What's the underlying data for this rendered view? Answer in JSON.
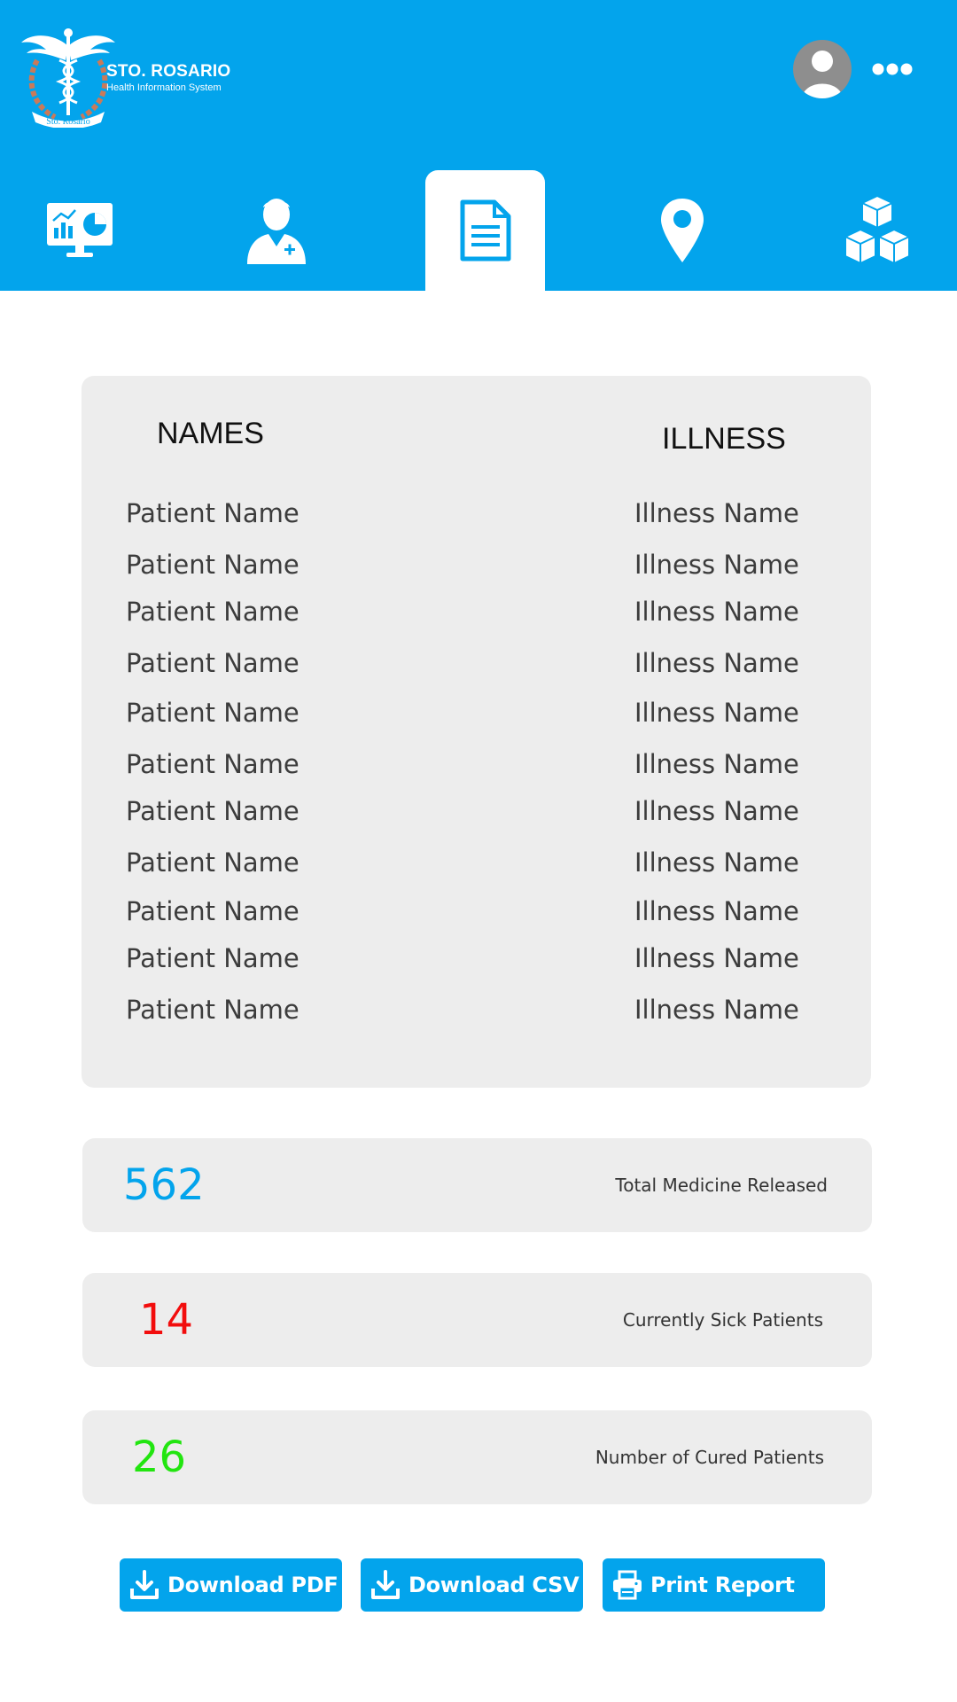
{
  "header": {
    "brand_name": "STO. ROSARIO",
    "brand_subtitle": "Health Information System",
    "logo_text": "Sto. Rosario",
    "bg_color": "#03A4EC"
  },
  "nav": {
    "tabs": [
      {
        "icon": "dashboard-monitor-icon",
        "active": false
      },
      {
        "icon": "doctor-icon",
        "active": false
      },
      {
        "icon": "document-icon",
        "active": true
      },
      {
        "icon": "location-pin-icon",
        "active": false
      },
      {
        "icon": "boxes-icon",
        "active": false
      }
    ]
  },
  "table": {
    "headers": {
      "names": "NAMES",
      "illness": "ILLNESS"
    },
    "rows": [
      {
        "name": "Patient Name",
        "illness": "Illness Name"
      },
      {
        "name": "Patient Name",
        "illness": "Illness Name"
      },
      {
        "name": "Patient Name",
        "illness": "Illness Name"
      },
      {
        "name": "Patient Name",
        "illness": "Illness Name"
      },
      {
        "name": "Patient Name",
        "illness": "Illness Name"
      },
      {
        "name": "Patient Name",
        "illness": "Illness Name"
      },
      {
        "name": "Patient Name",
        "illness": "Illness Name"
      },
      {
        "name": "Patient Name",
        "illness": "Illness Name"
      },
      {
        "name": "Patient Name",
        "illness": "Illness Name"
      },
      {
        "name": "Patient Name",
        "illness": "Illness Name"
      },
      {
        "name": "Patient Name",
        "illness": "Illness Name"
      }
    ]
  },
  "stats": {
    "medicine": {
      "value": "562",
      "label": "Total Medicine Released",
      "color": "#03A4EC"
    },
    "sick": {
      "value": "14",
      "label": "Currently Sick Patients",
      "color": "#F20D0D"
    },
    "cured": {
      "value": "26",
      "label": "Number of Cured Patients",
      "color": "#22E510"
    }
  },
  "actions": {
    "download_pdf": "Download PDF",
    "download_csv": "Download CSV",
    "print_report": "Print Report"
  }
}
